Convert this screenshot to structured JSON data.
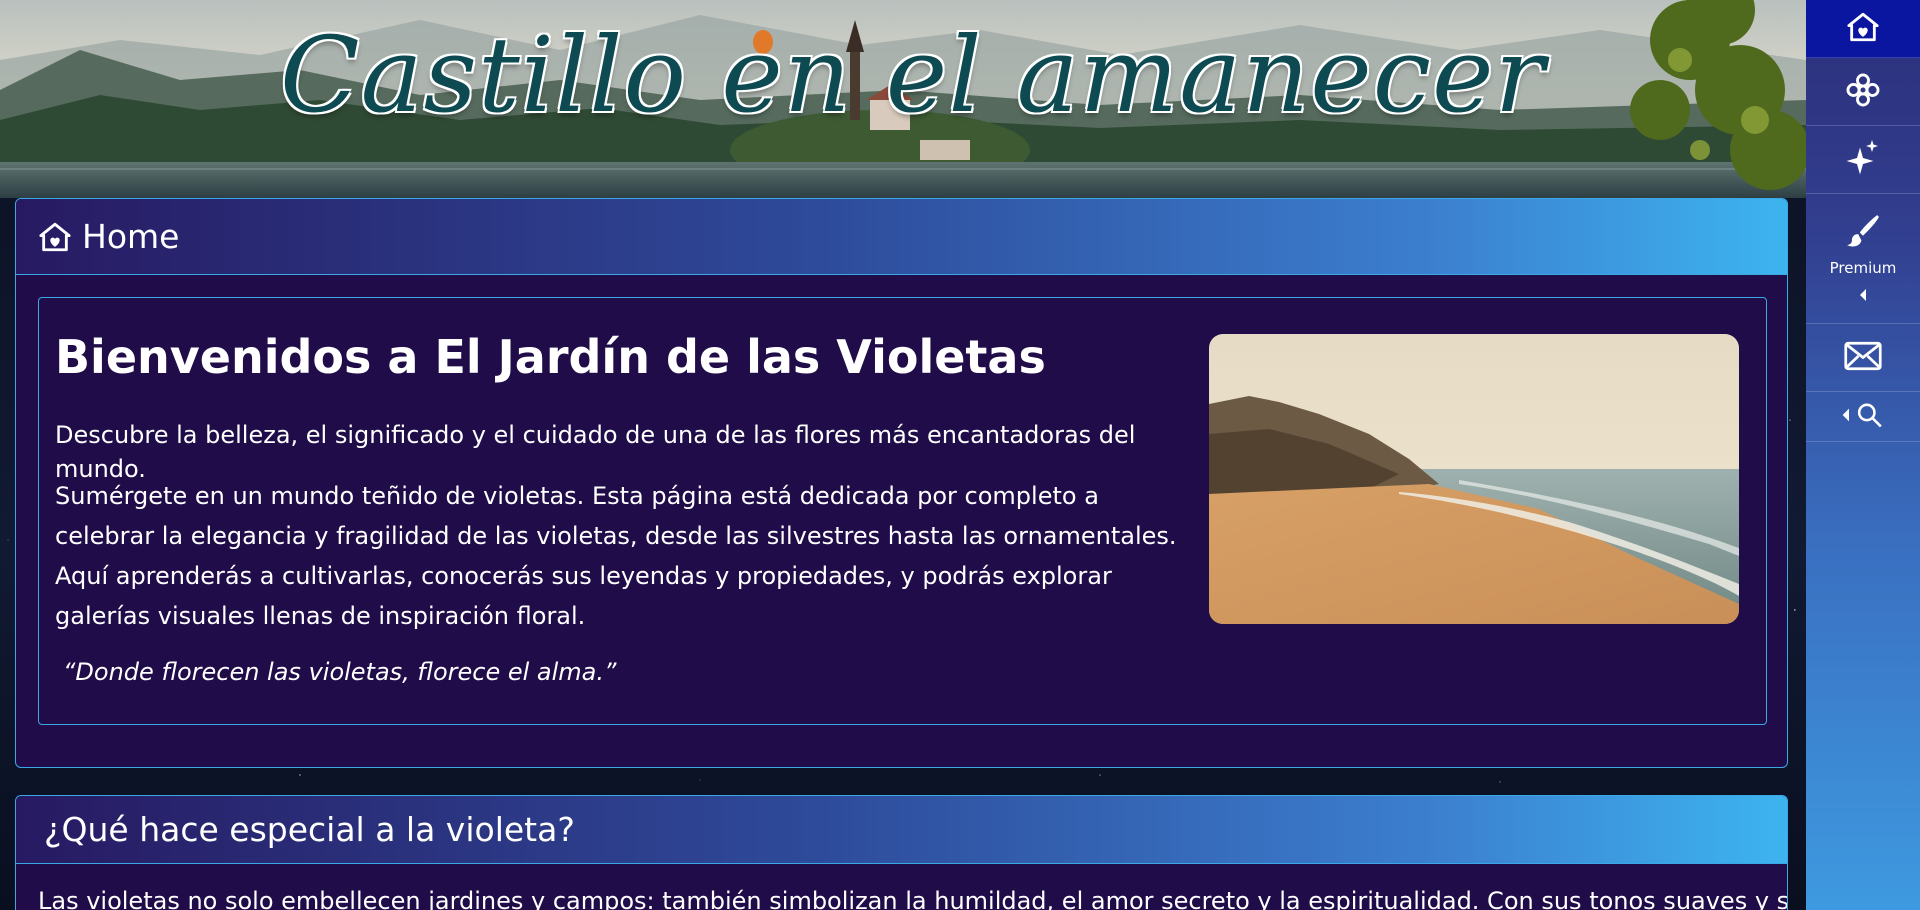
{
  "banner": {
    "title": "Castillo en el amanecer"
  },
  "sidebar": {
    "items": [
      {
        "icon": "home-icon",
        "label": ""
      },
      {
        "icon": "flower-icon",
        "label": ""
      },
      {
        "icon": "sparkles-icon",
        "label": ""
      },
      {
        "icon": "brush-icon",
        "label": "Premium"
      },
      {
        "icon": "envelope-icon",
        "label": ""
      },
      {
        "icon": "search-icon",
        "label": ""
      }
    ],
    "active_index": 0
  },
  "home_panel": {
    "header_icon": "home-icon",
    "header_label": "Home",
    "title": "Bienvenidos a El Jardín de las Violetas",
    "subtitle": "Descubre la belleza, el significado y el cuidado de una de las flores más encantadoras del mundo.",
    "body": "Sumérgete en un mundo teñido de violetas. Esta página está dedicada por completo a celebrar la elegancia y fragilidad de las violetas, desde las silvestres hasta las ornamentales. Aquí aprenderás a cultivarlas, conocerás sus leyendas y propiedades, y podrás explorar galerías visuales llenas de inspiración floral.",
    "quote": "“Donde florecen las violetas, florece el alma.”"
  },
  "special_panel": {
    "header_label": "¿Qué hace especial a la violeta?",
    "body": "Las violetas no solo embellecen jardines y campos: también simbolizan la humildad, el amor secreto y la espiritualidad. Con sus tonos suaves y su"
  },
  "colors": {
    "panel_bg": "#1f0c48",
    "border": "#3ba8e6",
    "sidebar_active": "#0a16a0",
    "title_teal": "#0e4a52"
  }
}
